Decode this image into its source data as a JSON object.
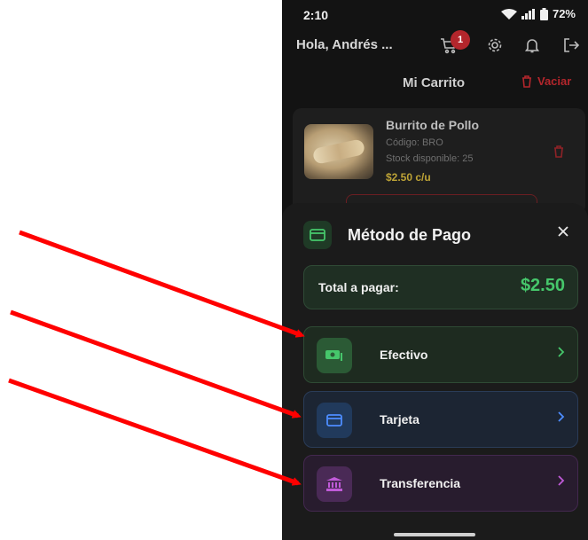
{
  "status_bar": {
    "time": "2:10",
    "battery": "72%"
  },
  "header": {
    "greeting": "Hola, Andrés ...",
    "cart_badge": "1",
    "icons": [
      "cart-icon",
      "gear-icon",
      "bell-icon",
      "logout-icon"
    ]
  },
  "cart": {
    "title": "Mi Carrito",
    "clear_label": "Vaciar",
    "item": {
      "name": "Burrito de Pollo",
      "code": "Código: BRO",
      "stock": "Stock disponible: 25",
      "price": "$2.50 c/u"
    }
  },
  "payment_sheet": {
    "title": "Método de Pago",
    "total_label": "Total a pagar:",
    "total_value": "$2.50",
    "options": [
      {
        "label": "Efectivo",
        "icon": "cash-icon",
        "color": "#46c76b"
      },
      {
        "label": "Tarjeta",
        "icon": "credit-card-icon",
        "color": "#4d8dff"
      },
      {
        "label": "Transferencia",
        "icon": "bank-icon",
        "color": "#c05ad8"
      }
    ]
  },
  "colors": {
    "danger": "#b3262c",
    "price": "#bda336",
    "annotation_arrow": "#ff0000"
  }
}
